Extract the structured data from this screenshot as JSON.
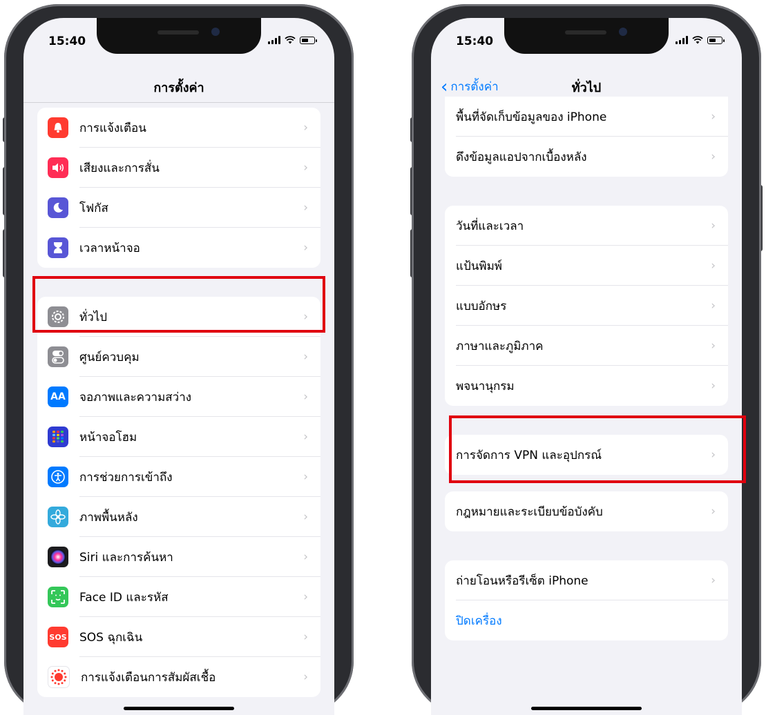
{
  "status_time": "15:40",
  "left": {
    "title": "การตั้งค่า",
    "groups": [
      [
        {
          "label": "การแจ้งเตือน",
          "icon": "bell-icon",
          "color": "#ff3b30"
        },
        {
          "label": "เสียงและการสั่น",
          "icon": "speaker-icon",
          "color": "#ff2d55"
        },
        {
          "label": "โฟกัส",
          "icon": "moon-icon",
          "color": "#5856d6"
        },
        {
          "label": "เวลาหน้าจอ",
          "icon": "hourglass-icon",
          "color": "#5856d6"
        }
      ],
      [
        {
          "label": "ทั่วไป",
          "icon": "gear-icon",
          "color": "#8e8e93"
        },
        {
          "label": "ศูนย์ควบคุม",
          "icon": "toggle-icon",
          "color": "#8e8e93"
        },
        {
          "label": "จอภาพและความสว่าง",
          "icon": "text-size-icon",
          "color": "#007aff",
          "glyph": "AA"
        },
        {
          "label": "หน้าจอโฮม",
          "icon": "grid-icon",
          "color": "#2f3bd1"
        },
        {
          "label": "การช่วยการเข้าถึง",
          "icon": "accessibility-icon",
          "color": "#007aff"
        },
        {
          "label": "ภาพพื้นหลัง",
          "icon": "flower-icon",
          "color": "#34aadc"
        },
        {
          "label": "Siri และการค้นหา",
          "icon": "siri-icon",
          "color": "#1c1c1e"
        },
        {
          "label": "Face ID และรหัส",
          "icon": "face-id-icon",
          "color": "#34c759"
        },
        {
          "label": "SOS ฉุกเฉิน",
          "icon": "sos-icon",
          "color": "#ff3b30",
          "glyph": "SOS"
        },
        {
          "label": "การแจ้งเตือนการสัมผัสเชื้อ",
          "icon": "exposure-icon",
          "color": "#ffffff"
        }
      ]
    ]
  },
  "right": {
    "back_label": "การตั้งค่า",
    "title": "ทั่วไป",
    "groups": [
      [
        {
          "label": "พื้นที่จัดเก็บข้อมูลของ iPhone"
        },
        {
          "label": "ดึงข้อมูลแอปจากเบื้องหลัง"
        }
      ],
      [
        {
          "label": "วันที่และเวลา"
        },
        {
          "label": "แป้นพิมพ์"
        },
        {
          "label": "แบบอักษร"
        },
        {
          "label": "ภาษาและภูมิภาค"
        },
        {
          "label": "พจนานุกรม"
        }
      ],
      [
        {
          "label": "การจัดการ VPN และอุปกรณ์"
        }
      ],
      [
        {
          "label": "กฎหมายและระเบียบข้อบังคับ"
        }
      ],
      [
        {
          "label": "ถ่ายโอนหรือรีเซ็ต iPhone"
        },
        {
          "label": "ปิดเครื่อง",
          "link": true
        }
      ]
    ]
  },
  "highlight_color": "#e0000e"
}
